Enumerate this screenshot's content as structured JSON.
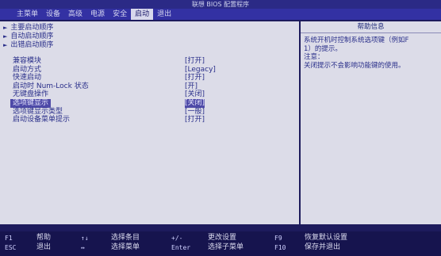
{
  "title": "联想 BIOS 配置程序",
  "menu": [
    "主菜单",
    "设备",
    "高级",
    "电源",
    "安全",
    "启动",
    "退出"
  ],
  "active_menu": "启动",
  "submenus": [
    "主要启动顺序",
    "自动启动顺序",
    "出错启动顺序"
  ],
  "settings": [
    {
      "label": "兼容模块",
      "value": "[打开]"
    },
    {
      "label": "启动方式",
      "value": "[Legacy]"
    },
    {
      "label": "快速启动",
      "value": "[打开]"
    },
    {
      "label": "启动时 Num-Lock 状态",
      "value": "[开]"
    },
    {
      "label": "无键盘操作",
      "value": "[关闭]"
    },
    {
      "label": "选项键显示",
      "value": "[关闭]"
    },
    {
      "label": "选项键显示类型",
      "value": "[一般]"
    },
    {
      "label": "启动设备菜单提示",
      "value": "[打开]"
    }
  ],
  "highlight_index": 5,
  "help": {
    "title": "帮助信息",
    "lines": [
      "系统开机时控制系统选项键（例如F",
      "1）的提示。",
      "注意：",
      "关闭提示不会影响功能键的使用。"
    ]
  },
  "footer": [
    {
      "key": "F1",
      "desc": "帮助"
    },
    {
      "key": "ESC",
      "desc": "退出"
    },
    {
      "key": "↑↓",
      "desc": "选择条目"
    },
    {
      "key": "↔",
      "desc": "选择菜单"
    },
    {
      "key": "+/-",
      "desc": "更改设置"
    },
    {
      "key": "Enter",
      "desc": "选择子菜单"
    },
    {
      "key": "F9",
      "desc": "恢复默认设置"
    },
    {
      "key": "F10",
      "desc": "保存并退出"
    }
  ]
}
